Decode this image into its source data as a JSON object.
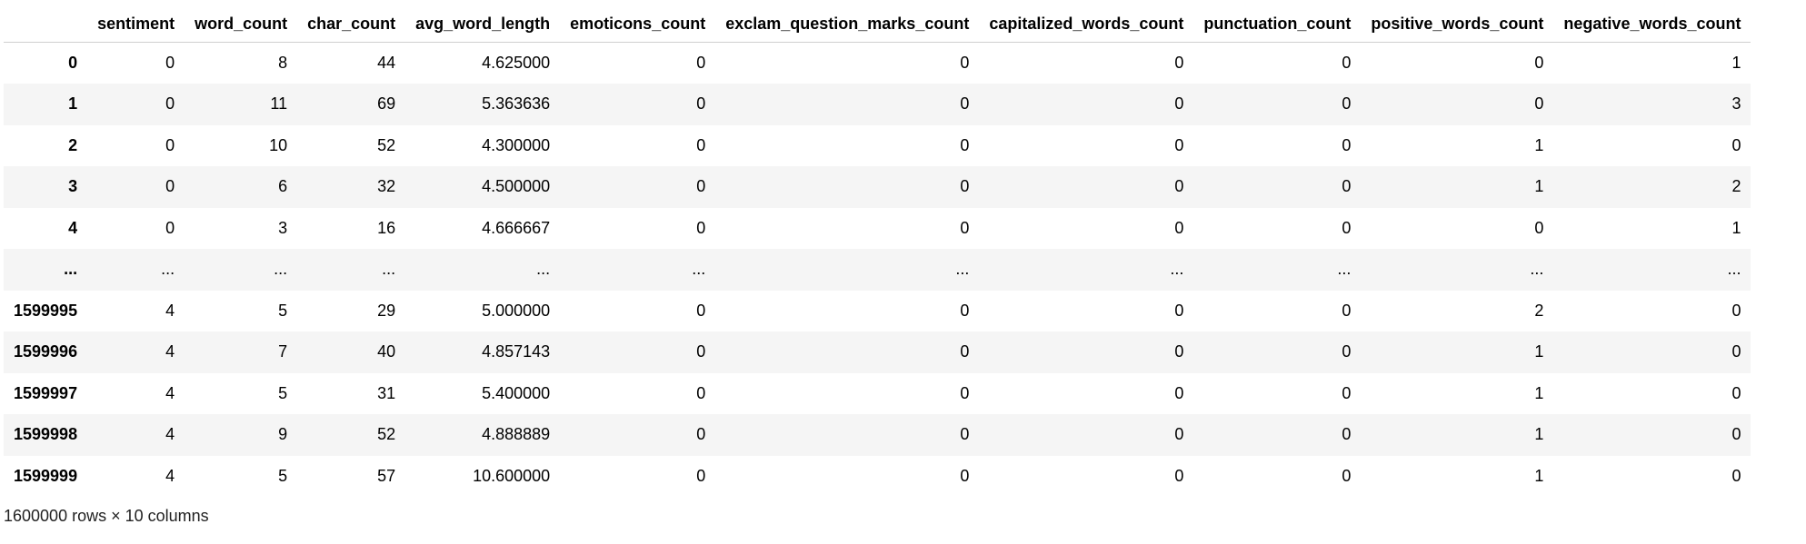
{
  "dataframe": {
    "columns": [
      "sentiment",
      "word_count",
      "char_count",
      "avg_word_length",
      "emoticons_count",
      "exclam_question_marks_count",
      "capitalized_words_count",
      "punctuation_count",
      "positive_words_count",
      "negative_words_count"
    ],
    "rows": [
      {
        "index": "0",
        "cells": [
          "0",
          "8",
          "44",
          "4.625000",
          "0",
          "0",
          "0",
          "0",
          "0",
          "1"
        ]
      },
      {
        "index": "1",
        "cells": [
          "0",
          "11",
          "69",
          "5.363636",
          "0",
          "0",
          "0",
          "0",
          "0",
          "3"
        ]
      },
      {
        "index": "2",
        "cells": [
          "0",
          "10",
          "52",
          "4.300000",
          "0",
          "0",
          "0",
          "0",
          "1",
          "0"
        ]
      },
      {
        "index": "3",
        "cells": [
          "0",
          "6",
          "32",
          "4.500000",
          "0",
          "0",
          "0",
          "0",
          "1",
          "2"
        ]
      },
      {
        "index": "4",
        "cells": [
          "0",
          "3",
          "16",
          "4.666667",
          "0",
          "0",
          "0",
          "0",
          "0",
          "1"
        ]
      },
      {
        "index": "...",
        "cells": [
          "...",
          "...",
          "...",
          "...",
          "...",
          "...",
          "...",
          "...",
          "...",
          "..."
        ]
      },
      {
        "index": "1599995",
        "cells": [
          "4",
          "5",
          "29",
          "5.000000",
          "0",
          "0",
          "0",
          "0",
          "2",
          "0"
        ]
      },
      {
        "index": "1599996",
        "cells": [
          "4",
          "7",
          "40",
          "4.857143",
          "0",
          "0",
          "0",
          "0",
          "1",
          "0"
        ]
      },
      {
        "index": "1599997",
        "cells": [
          "4",
          "5",
          "31",
          "5.400000",
          "0",
          "0",
          "0",
          "0",
          "1",
          "0"
        ]
      },
      {
        "index": "1599998",
        "cells": [
          "4",
          "9",
          "52",
          "4.888889",
          "0",
          "0",
          "0",
          "0",
          "1",
          "0"
        ]
      },
      {
        "index": "1599999",
        "cells": [
          "4",
          "5",
          "57",
          "10.600000",
          "0",
          "0",
          "0",
          "0",
          "1",
          "0"
        ]
      }
    ],
    "shape_note": "1600000 rows × 10 columns"
  }
}
